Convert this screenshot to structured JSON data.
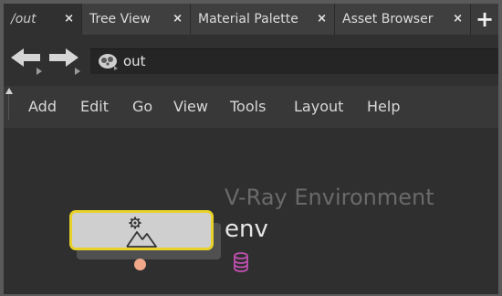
{
  "tabs": [
    {
      "label": "/out",
      "active": true
    },
    {
      "label": "Tree View",
      "active": false
    },
    {
      "label": "Material Palette",
      "active": false
    },
    {
      "label": "Asset Browser",
      "active": false
    }
  ],
  "tab_close_glyph": "×",
  "tab_add_glyph": "+",
  "path": {
    "value": "out",
    "context_icon": "rop-context-icon"
  },
  "menu": [
    "Add",
    "Edit",
    "Go",
    "View",
    "Tools",
    "Layout",
    "Help"
  ],
  "node": {
    "name": "env",
    "type_label": "V-Ray Environment",
    "icon": "environment-mountain-gear-icon",
    "selected_color": "#e8d22a",
    "output_connector_color": "#f0a78a",
    "render_flag_icon": "database-icon",
    "render_flag_color": "#c050b0"
  },
  "colors": {
    "background": "#2f2f2f",
    "tabbar": "#3b3b3b",
    "menubar": "#383838"
  }
}
